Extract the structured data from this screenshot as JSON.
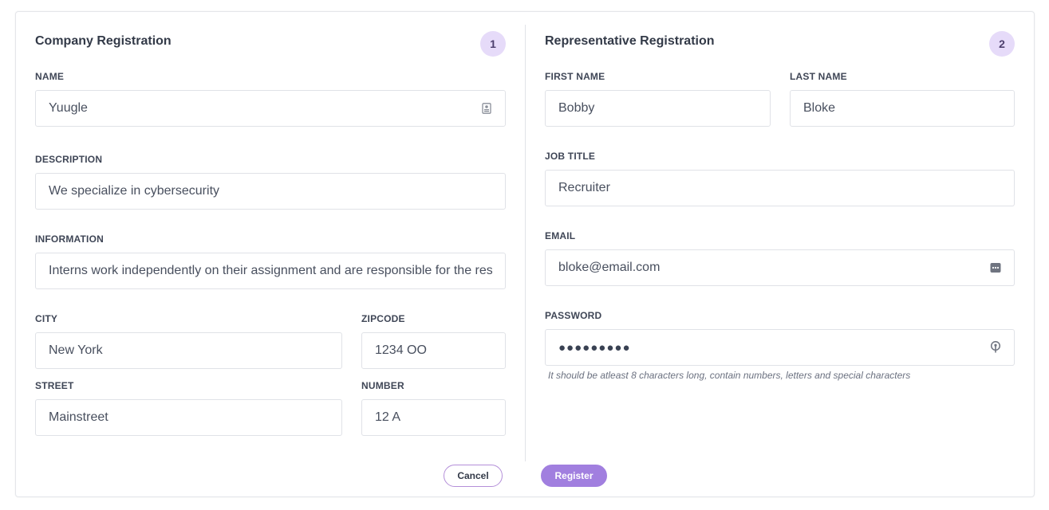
{
  "company": {
    "title": "Company Registration",
    "step": "1",
    "name": {
      "label": "NAME",
      "value": "Yuugle"
    },
    "description": {
      "label": "DESCRIPTION",
      "value": "We specialize in cybersecurity"
    },
    "information": {
      "label": "INFORMATION",
      "value": "Interns work independently on their assignment and are responsible for the resu"
    },
    "city": {
      "label": "CITY",
      "value": "New York"
    },
    "zipcode": {
      "label": "ZIPCODE",
      "value": "1234 OO"
    },
    "street": {
      "label": "STREET",
      "value": "Mainstreet"
    },
    "number": {
      "label": "NUMBER",
      "value": "12 A"
    }
  },
  "representative": {
    "title": "Representative Registration",
    "step": "2",
    "first_name": {
      "label": "FIRST NAME",
      "value": "Bobby"
    },
    "last_name": {
      "label": "LAST NAME",
      "value": "Bloke"
    },
    "job_title": {
      "label": "JOB TITLE",
      "value": "Recruiter"
    },
    "email": {
      "label": "EMAIL",
      "value": "bloke@email.com"
    },
    "password": {
      "label": "PASSWORD",
      "value": "●●●●●●●●●",
      "hint": "It should be atleast 8 characters long, contain numbers, letters and special characters"
    }
  },
  "actions": {
    "cancel_label": "Cancel",
    "register_label": "Register"
  },
  "icons": {
    "name_field": "contact-card-icon",
    "email_field": "autofill-dots-icon",
    "password_field": "key-icon"
  },
  "colors": {
    "accent": "#a17fdf",
    "badge": "#e6dbf9",
    "cancel_border": "#b48fd9"
  }
}
